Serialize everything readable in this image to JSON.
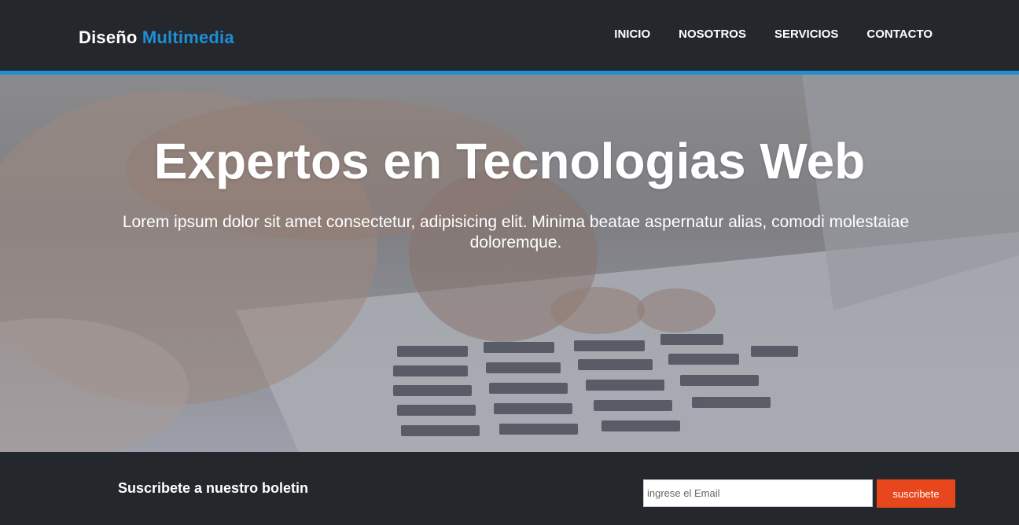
{
  "header": {
    "logo_text": "Diseño",
    "logo_accent": "Multimedia",
    "nav": [
      "INICIO",
      "NOSOTROS",
      "SERVICIOS",
      "CONTACTO"
    ]
  },
  "hero": {
    "title": "Expertos en Tecnologias Web",
    "text": "Lorem ipsum dolor sit amet consectetur, adipisicing elit. Minima beatae aspernatur alias, comodi molestaiae doloremque.",
    "image": "hands-typing-on-laptop-keyboard"
  },
  "newsletter": {
    "title": "Suscribete a nuestro boletin",
    "email_placeholder": "ingrese el Email",
    "button_label": "suscribete"
  },
  "colors": {
    "accent": "#1e8fd6",
    "dark": "#24272b",
    "button": "#e8471d"
  }
}
